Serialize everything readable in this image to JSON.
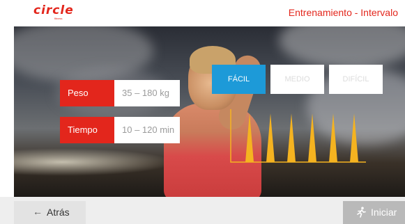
{
  "header": {
    "logo_text": "circle",
    "logo_subtext": "fitness",
    "title": "Entrenamiento - Intervalo"
  },
  "params": [
    {
      "label": "Peso",
      "value": "35 – 180 kg"
    },
    {
      "label": "Tiempo",
      "value": "10 – 120 min"
    }
  ],
  "levels": [
    {
      "label": "FÁCIL",
      "active": true
    },
    {
      "label": "MEDIO",
      "active": false
    },
    {
      "label": "DIFÍCIL",
      "active": false
    }
  ],
  "interval_profile": {
    "peak_count": 6,
    "peak_level": 1.0,
    "color": "#f5b320"
  },
  "footer": {
    "back_label": "Atrás",
    "back_icon": "arrow-left-icon",
    "start_label": "Iniciar",
    "start_icon": "running-icon"
  },
  "colors": {
    "brand_red": "#e3261c",
    "active_blue": "#1d9ad8",
    "peak_orange": "#f5b320"
  }
}
